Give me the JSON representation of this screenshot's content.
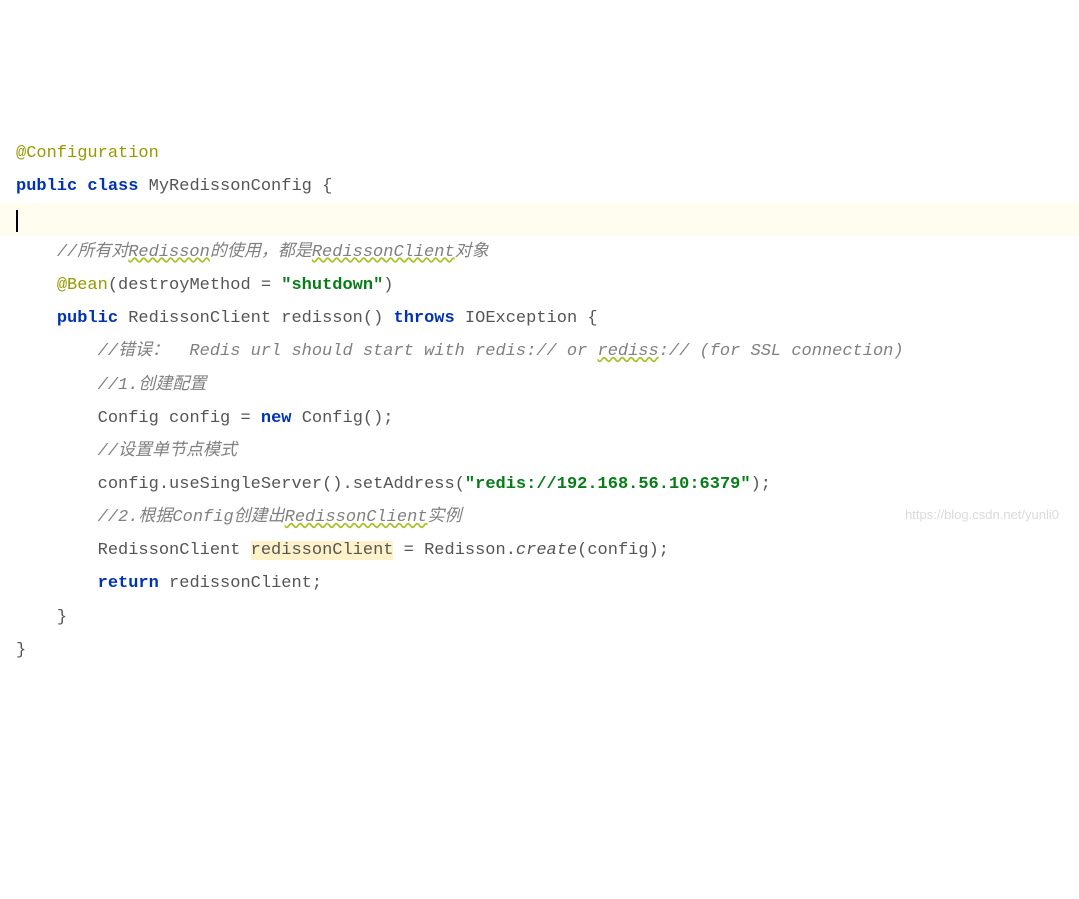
{
  "code": {
    "line1_annotation": "@Configuration",
    "line2_kw_public": "public",
    "line2_kw_class": "class",
    "line2_classname": "MyRedissonConfig",
    "line2_brace": " {",
    "line4_comment": "//所有对Redisson的使用，都是RedissonClient对象",
    "line4_comment_wavy1": "Redisson",
    "line4_comment_pre": "//所有对",
    "line4_comment_mid1": "的使用，都是",
    "line4_comment_wavy2": "RedissonClient",
    "line4_comment_end": "对象",
    "line5_annotation": "@Bean",
    "line5_paren_open": "(",
    "line5_param": "destroyMethod",
    "line5_eq": " = ",
    "line5_value": "\"shutdown\"",
    "line5_paren_close": ")",
    "line6_kw_public": "public",
    "line6_type": "RedissonClient",
    "line6_method": "redisson",
    "line6_parens": "()",
    "line6_kw_throws": "throws",
    "line6_exception": "IOException",
    "line6_brace": " {",
    "line7_comment_pre": "//错误：  Redis url should start with redis:// or ",
    "line7_comment_wavy": "rediss",
    "line7_comment_post": ":// (for SSL connection)",
    "line8_comment": "//1.创建配置",
    "line9_type1": "Config",
    "line9_var": "config",
    "line9_eq": " = ",
    "line9_kw_new": "new",
    "line9_type2": "Config",
    "line9_end": "();",
    "line10_comment": "//设置单节点模式",
    "line11_var": "config",
    "line11_dot1": ".",
    "line11_call1": "useSingleServer",
    "line11_p1": "().",
    "line11_call2": "setAddress",
    "line11_p2": "(",
    "line11_string": "\"redis://192.168.56.10:6379\"",
    "line11_end": ");",
    "line12_comment_pre": "//2.根据Config创建出",
    "line12_comment_wavy": "RedissonClient",
    "line12_comment_post": "实例",
    "line13_type": "RedissonClient",
    "line13_var": "redissonClient",
    "line13_eq": " = ",
    "line13_cls": "Redisson",
    "line13_dot": ".",
    "line13_call": "create",
    "line13_p1": "(",
    "line13_arg": "config",
    "line13_end": ");",
    "line14_kw_return": "return",
    "line14_var": "redissonClient",
    "line14_end": ";",
    "line15_brace": "}",
    "line16_brace": "}"
  },
  "watermark": "https://blog.csdn.net/yunli0"
}
